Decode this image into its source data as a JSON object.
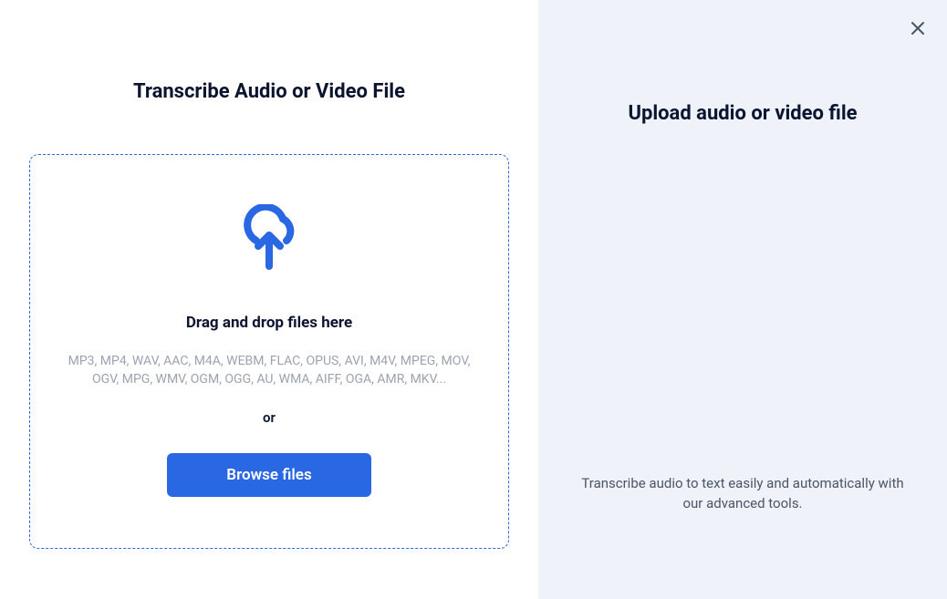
{
  "left": {
    "title": "Transcribe Audio or Video File",
    "drag_label": "Drag and drop files here",
    "formats": "MP3, MP4, WAV, AAC, M4A, WEBM, FLAC, OPUS, AVI, M4V, MPEG, MOV, OGV, MPG, WMV, OGM, OGG, AU, WMA, AIFF, OGA, AMR, MKV...",
    "or_label": "or",
    "browse_label": "Browse files"
  },
  "right": {
    "title": "Upload audio or video file",
    "description": "Transcribe audio to text easily and automatically with our advanced tools."
  },
  "colors": {
    "accent": "#2a67e3"
  }
}
